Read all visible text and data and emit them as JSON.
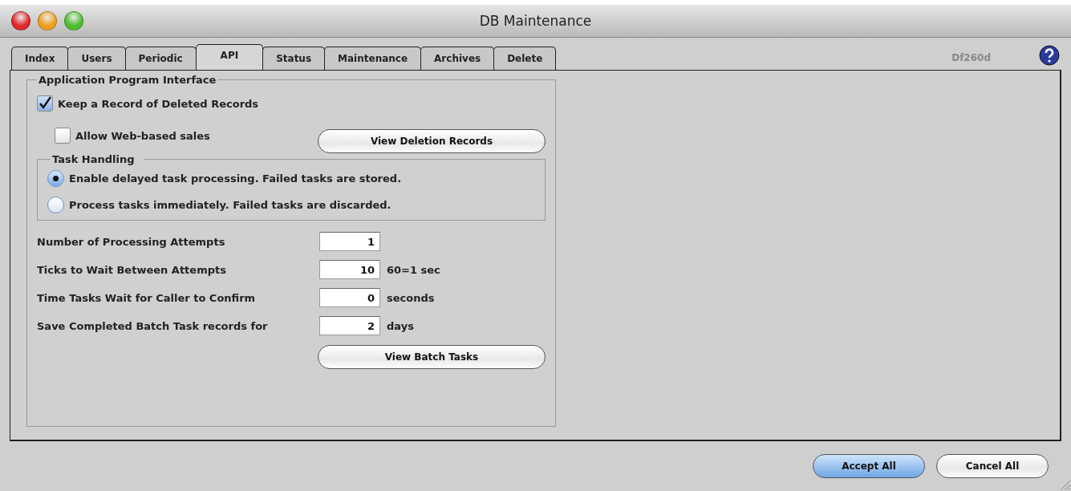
{
  "window": {
    "title": "DB Maintenance"
  },
  "tabs": [
    {
      "label": "Index",
      "selected": false
    },
    {
      "label": "Users",
      "selected": false
    },
    {
      "label": "Periodic",
      "selected": false
    },
    {
      "label": "API",
      "selected": true
    },
    {
      "label": "Status",
      "selected": false
    },
    {
      "label": "Maintenance",
      "selected": false
    },
    {
      "label": "Archives",
      "selected": false
    },
    {
      "label": "Delete",
      "selected": false
    }
  ],
  "version": "Df260d",
  "api_group": {
    "title": "Application Program Interface",
    "checkboxes": [
      {
        "label": "Keep a Record of Deleted Records",
        "checked": true
      },
      {
        "label": "Allow Web-based sales",
        "checked": false
      }
    ],
    "view_deletion_button": "View Deletion Records",
    "task_handling": {
      "title": "Task Handling",
      "options": [
        {
          "label": "Enable delayed task processing.  Failed tasks are stored.",
          "selected": true
        },
        {
          "label": "Process tasks immediately.  Failed tasks are discarded.",
          "selected": false
        }
      ]
    },
    "fields": [
      {
        "label": "Number of Processing Attempts",
        "value": "1"
      },
      {
        "label": "Ticks to Wait Between Attempts",
        "value": "10",
        "unit": "60=1 sec"
      },
      {
        "label": "Time Tasks Wait for Caller to Confirm",
        "value": "0",
        "unit": "seconds"
      },
      {
        "label": "Save Completed Batch Task records for",
        "value": "2",
        "unit": "days"
      }
    ],
    "view_batch_button": "View Batch Tasks"
  },
  "buttons": [
    {
      "label": "Accept All",
      "default": true
    },
    {
      "label": "Cancel All",
      "default": false
    }
  ]
}
